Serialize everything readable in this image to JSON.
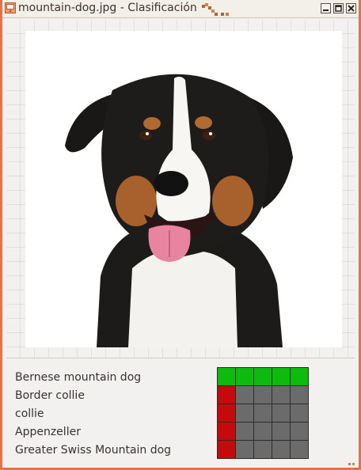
{
  "window": {
    "title": "mountain-dog.jpg - Clasificación"
  },
  "image": {
    "subject": "dog-photo"
  },
  "results": {
    "labels": [
      "Bernese mountain dog",
      "Border collie",
      "collie",
      "Appenzeller",
      "Greater Swiss Mountain dog"
    ],
    "scores": [
      [
        1,
        1,
        1,
        1,
        1
      ],
      [
        1,
        0,
        0,
        0,
        0
      ],
      [
        1,
        0,
        0,
        0,
        0
      ],
      [
        1,
        0,
        0,
        0,
        0
      ],
      [
        1,
        0,
        0,
        0,
        0
      ]
    ]
  },
  "colors": {
    "top_row": "#0fba0f",
    "other_rows": "#c40a0a",
    "empty": "#6b6b6b",
    "frame": "#e2734a"
  }
}
